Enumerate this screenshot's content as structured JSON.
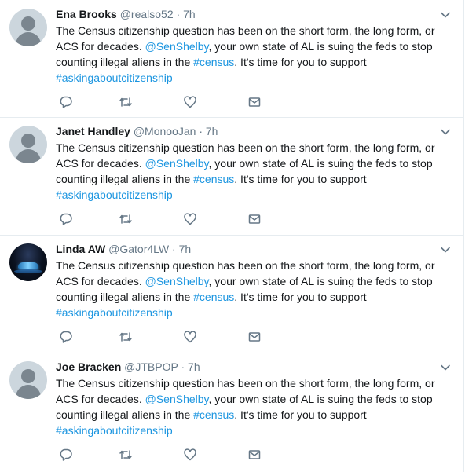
{
  "tweets": [
    {
      "name": "Ena Brooks",
      "handle": "@realso52",
      "sep": "·",
      "time": "7h",
      "text1": "The Census citizenship question has been on the short form, the long form, or ACS for decades. ",
      "mention": "@SenShelby",
      "text2": ", your own state of AL is suing the feds to stop counting illegal aliens in the ",
      "hashtag1": "#census",
      "text3": ". It's time for you to support ",
      "hashtag2": "#askingaboutcitizenship"
    },
    {
      "name": "Janet Handley",
      "handle": "@MonooJan",
      "sep": "·",
      "time": "7h",
      "text1": "The Census citizenship question has been on the short form, the long form, or ACS for decades. ",
      "mention": "@SenShelby",
      "text2": ", your own state of AL is suing the feds to stop counting illegal aliens in the ",
      "hashtag1": "#census",
      "text3": ". It's time for you to support ",
      "hashtag2": "#askingaboutcitizenship"
    },
    {
      "name": "Linda AW",
      "handle": "@Gator4LW",
      "sep": "·",
      "time": "7h",
      "text1": "The Census citizenship question has been on the short form, the long form, or ACS for decades. ",
      "mention": "@SenShelby",
      "text2": ", your own state of AL is suing the feds to stop counting illegal aliens in the ",
      "hashtag1": "#census",
      "text3": ". It's time for you to support ",
      "hashtag2": "#askingaboutcitizenship"
    },
    {
      "name": "Joe Bracken",
      "handle": "@JTBPOP",
      "sep": "·",
      "time": "7h",
      "text1": "The Census citizenship question has been on the short form, the long form, or ACS for decades. ",
      "mention": "@SenShelby",
      "text2": ", your own state of AL is suing the feds to stop counting illegal aliens in the ",
      "hashtag1": "#census",
      "text3": ". It's time for you to support ",
      "hashtag2": "#askingaboutcitizenship"
    }
  ],
  "icons": {
    "reply": "reply-icon",
    "retweet": "retweet-icon",
    "like": "heart-icon",
    "message": "envelope-icon",
    "menu": "chevron-down-icon"
  },
  "colors": {
    "link": "#1b95e0",
    "muted": "#657786",
    "text": "#14171a"
  }
}
